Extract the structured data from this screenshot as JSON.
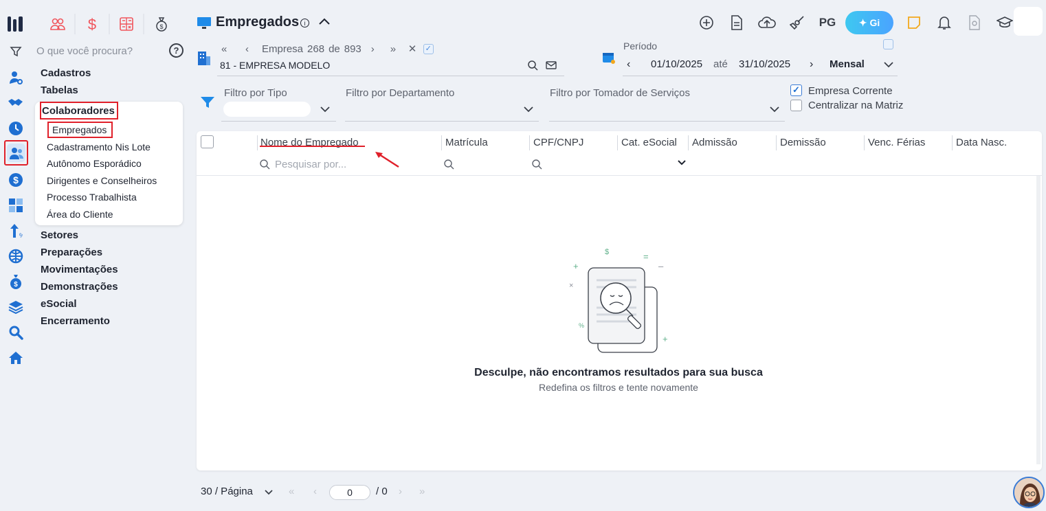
{
  "app": {
    "title": "Empregados",
    "search_placeholder": "O que você procura?"
  },
  "rail": {
    "icons": [
      "logo-icon",
      "filter-icon",
      "user-gear-icon",
      "handshake-icon",
      "clock-icon",
      "people-icon",
      "dollar-icon",
      "calculator-icon",
      "upload-percent-icon",
      "globe-grid-icon",
      "money-bag-icon",
      "layers-icon",
      "magnifier-icon",
      "home-icon"
    ]
  },
  "menu": {
    "items": [
      "Cadastros",
      "Tabelas",
      "Colaboradores",
      "Setores",
      "Preparações",
      "Movimentações",
      "Demonstrações",
      "eSocial",
      "Encerramento"
    ],
    "sub_items": [
      "Empregados",
      "Cadastramento Nis Lote",
      "Autônomo Esporádico",
      "Dirigentes e Conselheiros",
      "Processo Trabalhista",
      "Área do Cliente"
    ]
  },
  "toolbar": {
    "pg_label": "PG",
    "gi_label": "Gi"
  },
  "empresa": {
    "label": "Empresa",
    "current": "268",
    "of": "de",
    "total": "893",
    "name": "81 - EMPRESA MODELO"
  },
  "periodo": {
    "label": "Período",
    "from": "01/10/2025",
    "until_label": "até",
    "to": "31/10/2025",
    "mode": "Mensal"
  },
  "filters": {
    "tipo": "Filtro por Tipo",
    "departamento": "Filtro por Departamento",
    "tomador": "Filtro por Tomador de Serviços",
    "empresa_corrente": "Empresa Corrente",
    "centralizar": "Centralizar na Matriz"
  },
  "table": {
    "columns": [
      "Nome do Empregado",
      "Matrícula",
      "CPF/CNPJ",
      "Cat. eSocial",
      "Admissão",
      "Demissão",
      "Venc. Férias",
      "Data Nasc."
    ],
    "search_placeholder": "Pesquisar por..."
  },
  "empty": {
    "title": "Desculpe, não encontramos resultados para sua busca",
    "subtitle": "Redefina os filtros e tente novamente"
  },
  "pagination": {
    "per_page": "30 / Página",
    "page": "0",
    "total": "/ 0"
  },
  "colors": {
    "accent_red": "#e0202a",
    "brand_blue": "#1f6fd1",
    "gi_gradient_start": "#3ec8f0"
  }
}
